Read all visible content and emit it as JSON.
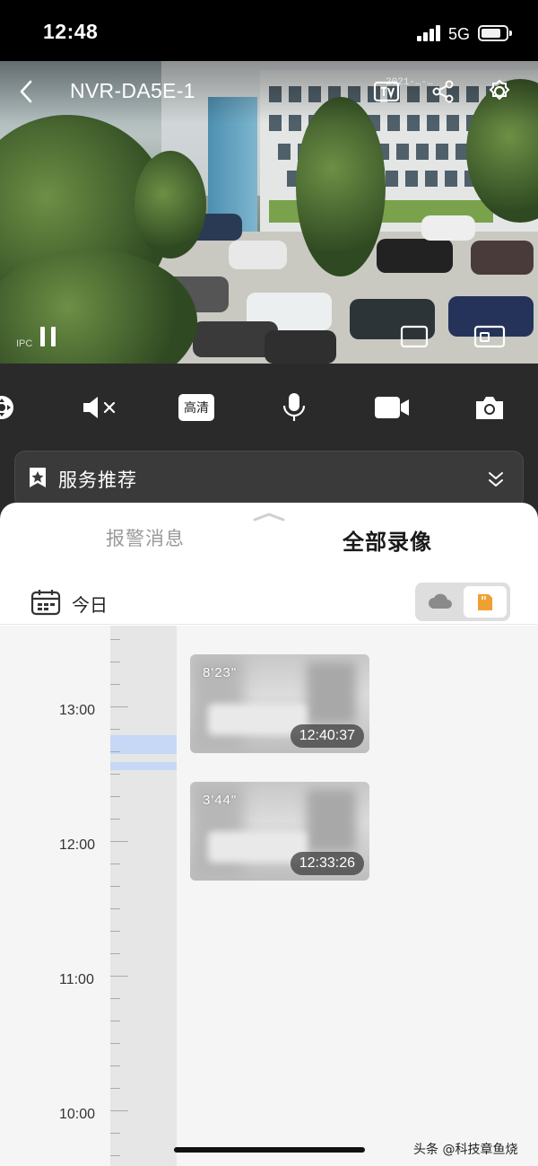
{
  "status_bar": {
    "time": "12:48",
    "network": "5G",
    "battery_level": 0.8
  },
  "header": {
    "title": "NVR-DA5E-1",
    "back_icon": "back-arrow-icon",
    "tv_icon": "tv-icon",
    "share_icon": "share-icon",
    "settings_icon": "gear-icon"
  },
  "video": {
    "timestamp": "2021-…-…",
    "label": "IPC",
    "pause_icon": "pause-icon",
    "fullscreen_icon": "fullscreen-icon",
    "pip_icon": "pip-icon"
  },
  "controls": {
    "ptz_icon": "ptz-icon",
    "mute_icon": "speaker-muted-icon",
    "quality_label": "高清",
    "mic_icon": "microphone-icon",
    "record_icon": "video-camera-icon",
    "snapshot_icon": "camera-icon"
  },
  "service": {
    "label": "服务推荐",
    "icon": "star-badge-icon",
    "expand_icon": "double-chevron-down-icon"
  },
  "tabs": [
    {
      "label": "报警消息",
      "active": false
    },
    {
      "label": "全部录像",
      "active": true
    }
  ],
  "date_filter": {
    "label": "今日",
    "icon": "calendar-icon",
    "storage_toggle": {
      "options": [
        "cloud",
        "sd-card"
      ],
      "selected": "sd-card"
    },
    "accent": "#f0a033"
  },
  "timeline": {
    "hours": [
      "13:00",
      "12:00",
      "11:00",
      "10:00"
    ],
    "recording_color": "#c6d8f5"
  },
  "clips": [
    {
      "duration": "8'23\"",
      "start_time": "12:40:37"
    },
    {
      "duration": "3'44\"",
      "start_time": "12:33:26"
    }
  ],
  "watermark": "头条 @科技章鱼烧"
}
